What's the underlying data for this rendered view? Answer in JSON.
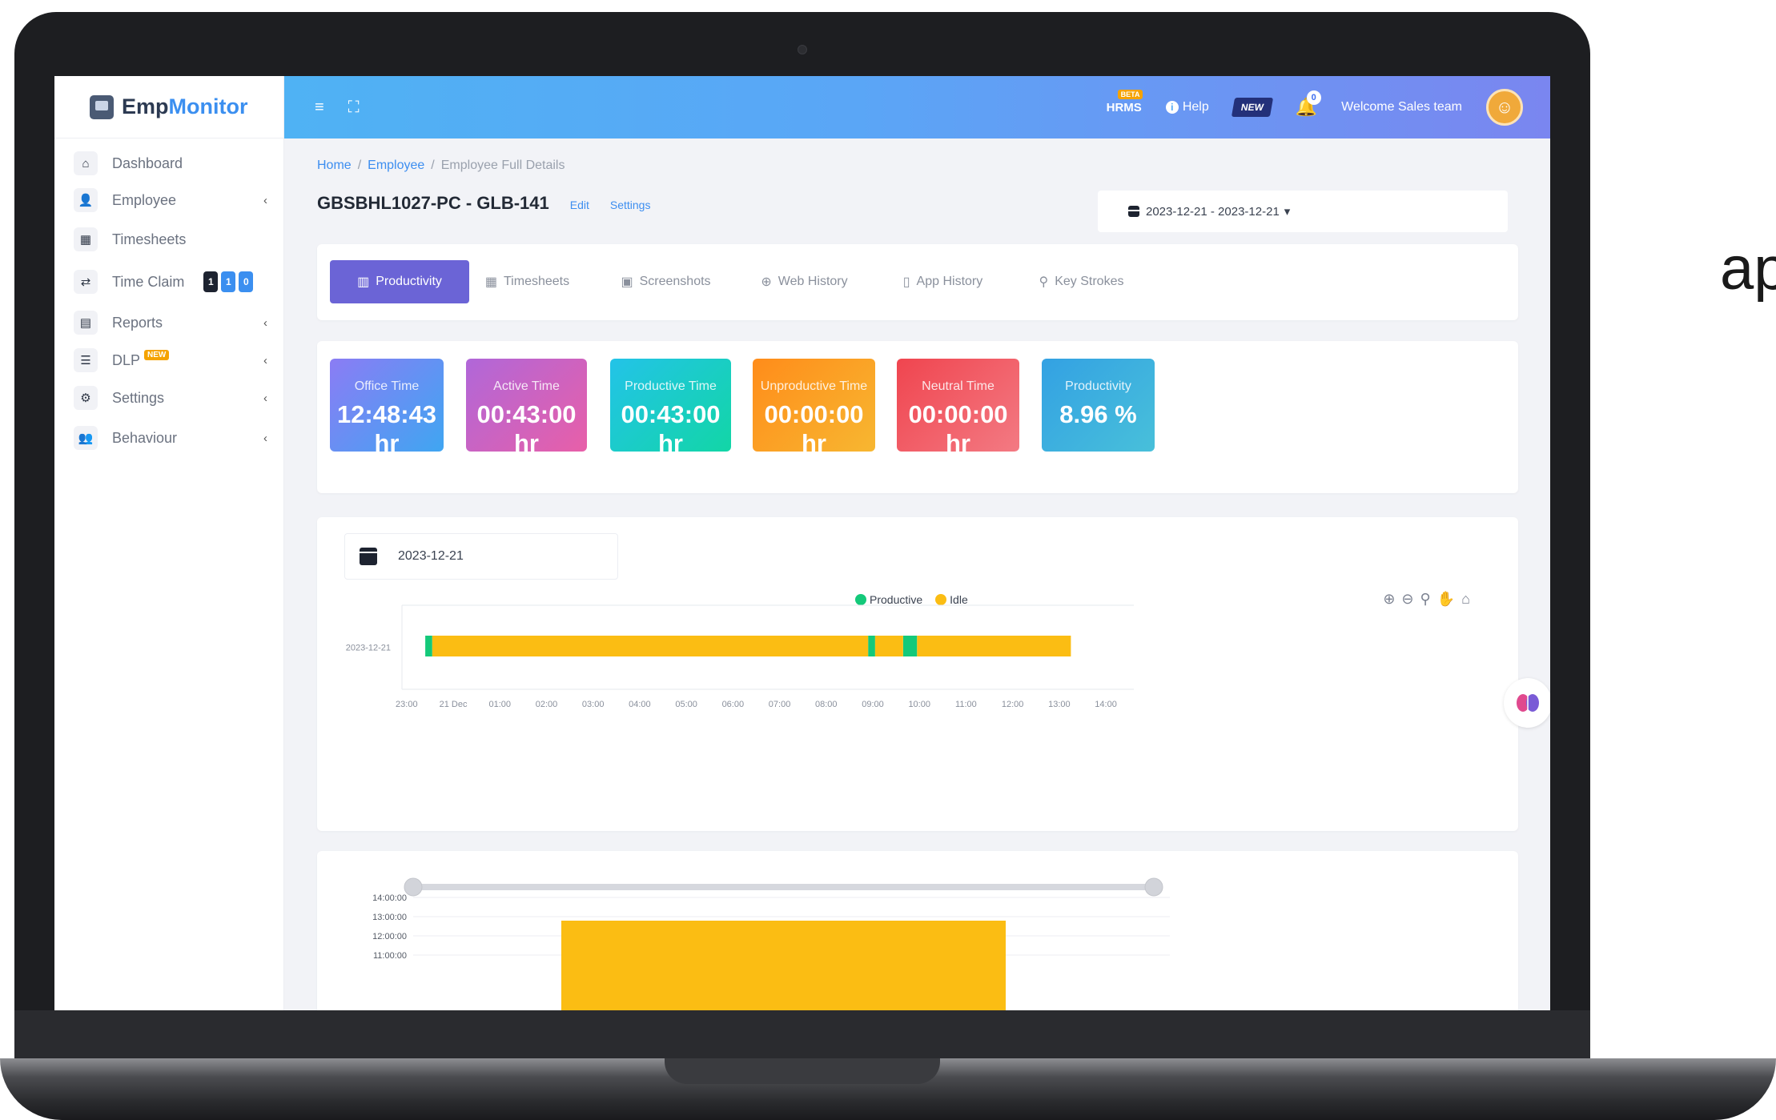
{
  "side_text": "ap",
  "brand": {
    "name_a": "Emp",
    "name_b": "Monitor"
  },
  "sidebar": {
    "items": [
      {
        "label": "Dashboard",
        "icon": "home-icon",
        "glyph": "⌂",
        "has_chevron": false
      },
      {
        "label": "Employee",
        "icon": "employee-icon",
        "glyph": "👤",
        "has_chevron": true
      },
      {
        "label": "Timesheets",
        "icon": "calendar-icon",
        "glyph": "▦",
        "has_chevron": false
      },
      {
        "label": "Time Claim",
        "icon": "transfer-icon",
        "glyph": "⇄",
        "has_chevron": false
      },
      {
        "label": "Reports",
        "icon": "report-icon",
        "glyph": "▤",
        "has_chevron": true
      },
      {
        "label": "DLP",
        "icon": "sliders-icon",
        "glyph": "☰",
        "has_chevron": true
      },
      {
        "label": "Settings",
        "icon": "gear-icon",
        "glyph": "⚙",
        "has_chevron": true
      },
      {
        "label": "Behaviour",
        "icon": "users-icon",
        "glyph": "👥",
        "has_chevron": true
      }
    ],
    "dlp_badge": "NEW",
    "time_claim_counts": [
      "1",
      "1",
      "0"
    ],
    "time_claim_colors": [
      "#1d2330",
      "#3b8ff0",
      "#3b8ff0"
    ],
    "chevron": "‹"
  },
  "topbar": {
    "menu_glyph": "≡",
    "expand_glyph": "⛶",
    "hrms": "HRMS",
    "beta": "BETA",
    "help": "Help",
    "new_flag": "NEW",
    "bell_count": "0",
    "welcome": "Welcome Sales team"
  },
  "breadcrumb": {
    "home": "Home",
    "employee": "Employee",
    "current": "Employee Full Details",
    "sep": "/"
  },
  "employee": {
    "title": "GBSBHL1027-PC - GLB-141",
    "edit": "Edit",
    "settings": "Settings"
  },
  "date_range": "2023-12-21 - 2023-12-21",
  "tabs": [
    {
      "label": "Productivity",
      "glyph": "▥",
      "active": true
    },
    {
      "label": "Timesheets",
      "glyph": "▦",
      "active": false
    },
    {
      "label": "Screenshots",
      "glyph": "▣",
      "active": false
    },
    {
      "label": "Web History",
      "glyph": "⊕",
      "active": false
    },
    {
      "label": "App History",
      "glyph": "▯",
      "active": false
    },
    {
      "label": "Key Strokes",
      "glyph": "⚲",
      "active": false
    }
  ],
  "stats": [
    {
      "label": "Office Time",
      "value": "12:48:43 hr",
      "colors": [
        "#8b7cf4",
        "#3fa6f2"
      ]
    },
    {
      "label": "Active Time",
      "value": "00:43:00 hr",
      "colors": [
        "#b067d9",
        "#e85fa8"
      ]
    },
    {
      "label": "Productive Time",
      "value": "00:43:00 hr",
      "colors": [
        "#23c3e8",
        "#12d6a6"
      ]
    },
    {
      "label": "Unproductive Time",
      "value": "00:00:00 hr",
      "colors": [
        "#ff8c1a",
        "#f7b731"
      ]
    },
    {
      "label": "Neutral Time",
      "value": "00:00:00 hr",
      "colors": [
        "#f0454f",
        "#f37a83"
      ]
    },
    {
      "label": "Productivity",
      "value": "8.96 %",
      "colors": [
        "#33a1e3",
        "#48c0da"
      ]
    }
  ],
  "timeline": {
    "date_value": "2023-12-21",
    "legend": [
      {
        "label": "Productive",
        "color": "#14c97a"
      },
      {
        "label": "Idle",
        "color": "#fbbd13"
      }
    ],
    "toolbar_icons": [
      {
        "name": "zoom-in-icon",
        "glyph": "⊕"
      },
      {
        "name": "zoom-out-icon",
        "glyph": "⊖"
      },
      {
        "name": "magnifier-icon",
        "glyph": "⚲"
      },
      {
        "name": "pan-hand-icon",
        "glyph": "✋"
      },
      {
        "name": "home-reset-icon",
        "glyph": "⌂"
      }
    ]
  },
  "chart_data": [
    {
      "type": "bar",
      "orientation": "horizontal-timeline",
      "categories": [
        "2023-12-21"
      ],
      "x_tick_labels": [
        "23:00",
        "21 Dec",
        "01:00",
        "02:00",
        "03:00",
        "04:00",
        "05:00",
        "06:00",
        "07:00",
        "08:00",
        "09:00",
        "10:00",
        "11:00",
        "12:00",
        "13:00",
        "14:00"
      ],
      "xlim": [
        -1.1,
        14.6
      ],
      "series": [
        {
          "name": "Productive",
          "color": "#14c97a",
          "segments": [
            [
              -0.6,
              -0.45
            ],
            [
              8.9,
              9.05
            ],
            [
              9.65,
              9.95
            ]
          ]
        },
        {
          "name": "Idle",
          "color": "#fbbd13",
          "segments": [
            [
              -0.45,
              8.9
            ],
            [
              9.05,
              9.65
            ],
            [
              9.95,
              13.25
            ]
          ]
        }
      ],
      "grid": false,
      "legend": "top-center"
    },
    {
      "type": "bar",
      "y_tick_labels": [
        "14:00:00",
        "13:00:00",
        "12:00:00",
        "11:00:00"
      ],
      "bar": {
        "color": "#fbbd13",
        "x_start_fraction": 0.2,
        "x_end_fraction": 0.8,
        "y_top": "12:42"
      },
      "range_slider": {
        "start": 0,
        "end": 1
      },
      "grid": true
    }
  ]
}
